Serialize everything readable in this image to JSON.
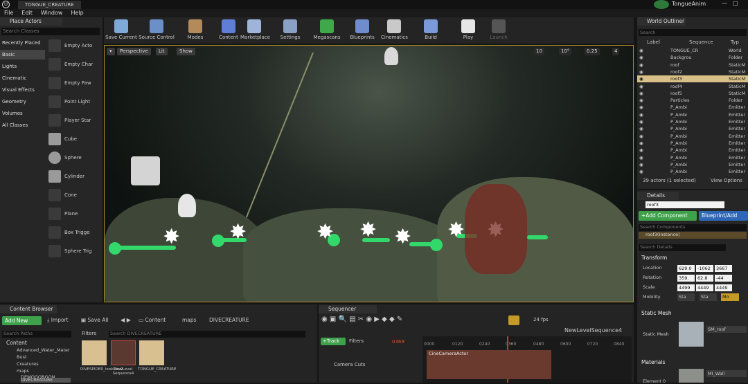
{
  "app": {
    "tab_title": "TONGUE_CREATURE",
    "project": "TongueAnim"
  },
  "menu": [
    "File",
    "Edit",
    "Window",
    "Help"
  ],
  "toolbar": [
    {
      "label": "Save Current",
      "icon": "save-icon"
    },
    {
      "label": "Source Control",
      "icon": "source-control-icon"
    },
    {
      "label": "Modes",
      "icon": "modes-icon"
    },
    {
      "label": "Content",
      "icon": "content-icon"
    },
    {
      "label": "Marketplace",
      "icon": "marketplace-icon"
    },
    {
      "label": "Settings",
      "icon": "settings-icon"
    },
    {
      "label": "Megascans",
      "icon": "megascans-icon"
    },
    {
      "label": "Blueprints",
      "icon": "blueprints-icon"
    },
    {
      "label": "Cinematics",
      "icon": "cinematics-icon"
    },
    {
      "label": "Build",
      "icon": "build-icon"
    },
    {
      "label": "Play",
      "icon": "play-icon"
    },
    {
      "label": "Launch",
      "icon": "launch-icon"
    }
  ],
  "place_actors": {
    "tab": "Place Actors",
    "search_placeholder": "Search Classes",
    "categories": [
      "Recently Placed",
      "Basic",
      "Lights",
      "Cinematic",
      "Visual Effects",
      "Geometry",
      "Volumes",
      "All Classes"
    ],
    "selected_category": "Basic",
    "items": [
      "Empty Acto",
      "Empty Char",
      "Empty Paw",
      "Point Light",
      "Player Star",
      "Cube",
      "Sphere",
      "Cylinder",
      "Cone",
      "Plane",
      "Box Trigge",
      "Sphere Trig"
    ]
  },
  "viewport": {
    "buttons": [
      "Perspective",
      "Lit",
      "Show"
    ],
    "right_values": [
      "10",
      "10°",
      "0.25",
      "4"
    ]
  },
  "outliner": {
    "tab": "World Outliner",
    "search_placeholder": "Search",
    "columns": [
      "Label",
      "Sequence",
      "Typ"
    ],
    "rows": [
      {
        "name": "TONGUE_CR",
        "type": "World"
      },
      {
        "name": "Backgrou",
        "type": "Folder"
      },
      {
        "name": "roof",
        "type": "StaticM"
      },
      {
        "name": "roof2",
        "type": "StaticM"
      },
      {
        "name": "roof3",
        "type": "StaticM",
        "selected": true
      },
      {
        "name": "roof4",
        "type": "StaticM"
      },
      {
        "name": "roof5",
        "type": "StaticM"
      },
      {
        "name": "Particles",
        "type": "Folder"
      },
      {
        "name": "P_Ambi",
        "type": "Emitter"
      },
      {
        "name": "P_Ambi",
        "type": "Emitter"
      },
      {
        "name": "P_Ambi",
        "type": "Emitter"
      },
      {
        "name": "P_Ambi",
        "type": "Emitter"
      },
      {
        "name": "P_Ambi",
        "type": "Emitter"
      },
      {
        "name": "P_Ambi",
        "type": "Emitter"
      },
      {
        "name": "P_Ambi",
        "type": "Emitter"
      },
      {
        "name": "P_Ambi",
        "type": "Emitter"
      },
      {
        "name": "P_Ambi",
        "type": "Emitter"
      },
      {
        "name": "P_Ambi",
        "type": "Emitter"
      }
    ],
    "footer": "39 actors (1 selected)",
    "view_options": "View Options"
  },
  "details": {
    "tab": "Details",
    "name": "roof3",
    "add_component": "+Add Component",
    "blueprint": "Blueprint/Add",
    "search_components": "Search Components",
    "instance": "roof3(Instance)",
    "search_details": "Search Details",
    "transform": "Transform",
    "location_label": "Location",
    "rotation_label": "Rotation",
    "scale_label": "Scale",
    "mobility_label": "Mobility",
    "location": [
      "629.0",
      "-1062",
      "3667"
    ],
    "rotation": [
      "359.",
      "62.8",
      "-44"
    ],
    "scale": [
      "4499",
      "4449",
      "4449"
    ],
    "mobility": [
      "Sta",
      "Sta",
      "Mo"
    ],
    "static_mesh_section": "Static Mesh",
    "static_mesh_label": "Static Mesh",
    "static_mesh_value": "SM_roof",
    "materials_section": "Materials",
    "element_label": "Element 0",
    "material_value": "MI_Wall"
  },
  "content_browser": {
    "tab": "Content Browser",
    "add_new": "Add New",
    "import": "Import",
    "save_all": "Save All",
    "path": [
      "Content",
      "maps",
      "DIVECREATURE"
    ],
    "search_paths": "Search Paths",
    "filters": "Filters",
    "search_placeholder": "Search DIVECREATURE",
    "tree": [
      "Content",
      "Advanced_Water_Mater",
      "Bust",
      "Creatures",
      "maps",
      "DEMOGORGON",
      "DIVECREATURE"
    ],
    "assets": [
      "DIVESPIDER_lookDev2",
      "NewLevel Sequence4",
      "TONGUE_CREATURE"
    ]
  },
  "sequencer": {
    "tab": "Sequencer",
    "fps": "24 fps",
    "sequence": "NewLevelSequence4",
    "track": "+Track",
    "filters": "Filters",
    "frame": "0369",
    "ticks": [
      "0000",
      "0120",
      "0240",
      "0360",
      "0480",
      "0600",
      "0720",
      "0840"
    ],
    "rows": [
      "Camera Cuts"
    ],
    "clip": "CineCameraActor"
  }
}
